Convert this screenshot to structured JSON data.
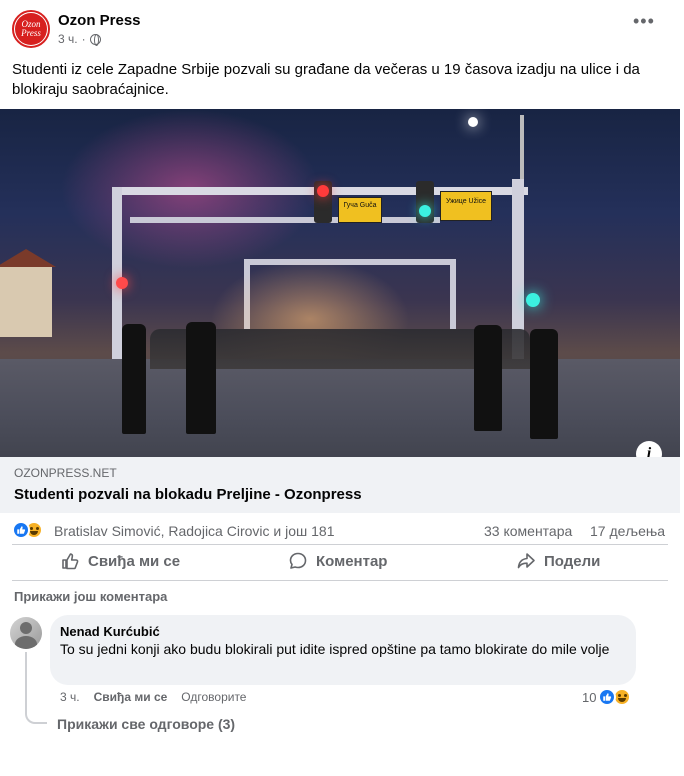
{
  "post": {
    "page_name": "Ozon Press",
    "avatar_text_top": "Ozon",
    "avatar_text_bottom": "Press",
    "time": "3 ч.",
    "separator": "·",
    "more_icon": "more-horizontal-icon",
    "text": "Studenti iz cele Zapadne Srbije pozvali su građane da večeras u 19 časova izadju na ulice i da blokiraju saobraćajnice.",
    "image": {
      "sign_left": "Гуча Guča",
      "sign_right": "Ужице Užice",
      "info_label": "i"
    },
    "link": {
      "domain": "OZONPRESS.NET",
      "title": "Studenti pozvali na blokadu Preljine - Ozonpress"
    }
  },
  "stats": {
    "reaction_names": "Bratislav Simović, Radojica Cirovic и још 181",
    "comments": "33 коментара",
    "shares": "17 дељења",
    "reaction_colors": {
      "like": "#1877f2",
      "haha": "#f7b125"
    }
  },
  "actions": {
    "like": "Свиђа ми се",
    "comment": "Коментар",
    "share": "Подели"
  },
  "comments": {
    "show_more": "Прикажи још коментара",
    "items": [
      {
        "author": "Nenad Kurćubić",
        "text": "To su jedni konji ako budu blokirali put idite ispred opštine pa tamo blokirate do mile volje",
        "time": "3 ч.",
        "like_label": "Свиђа ми се",
        "reply_label": "Одговорите",
        "reaction_count": "10"
      }
    ],
    "view_replies": "Прикажи све одговоре (3)"
  }
}
